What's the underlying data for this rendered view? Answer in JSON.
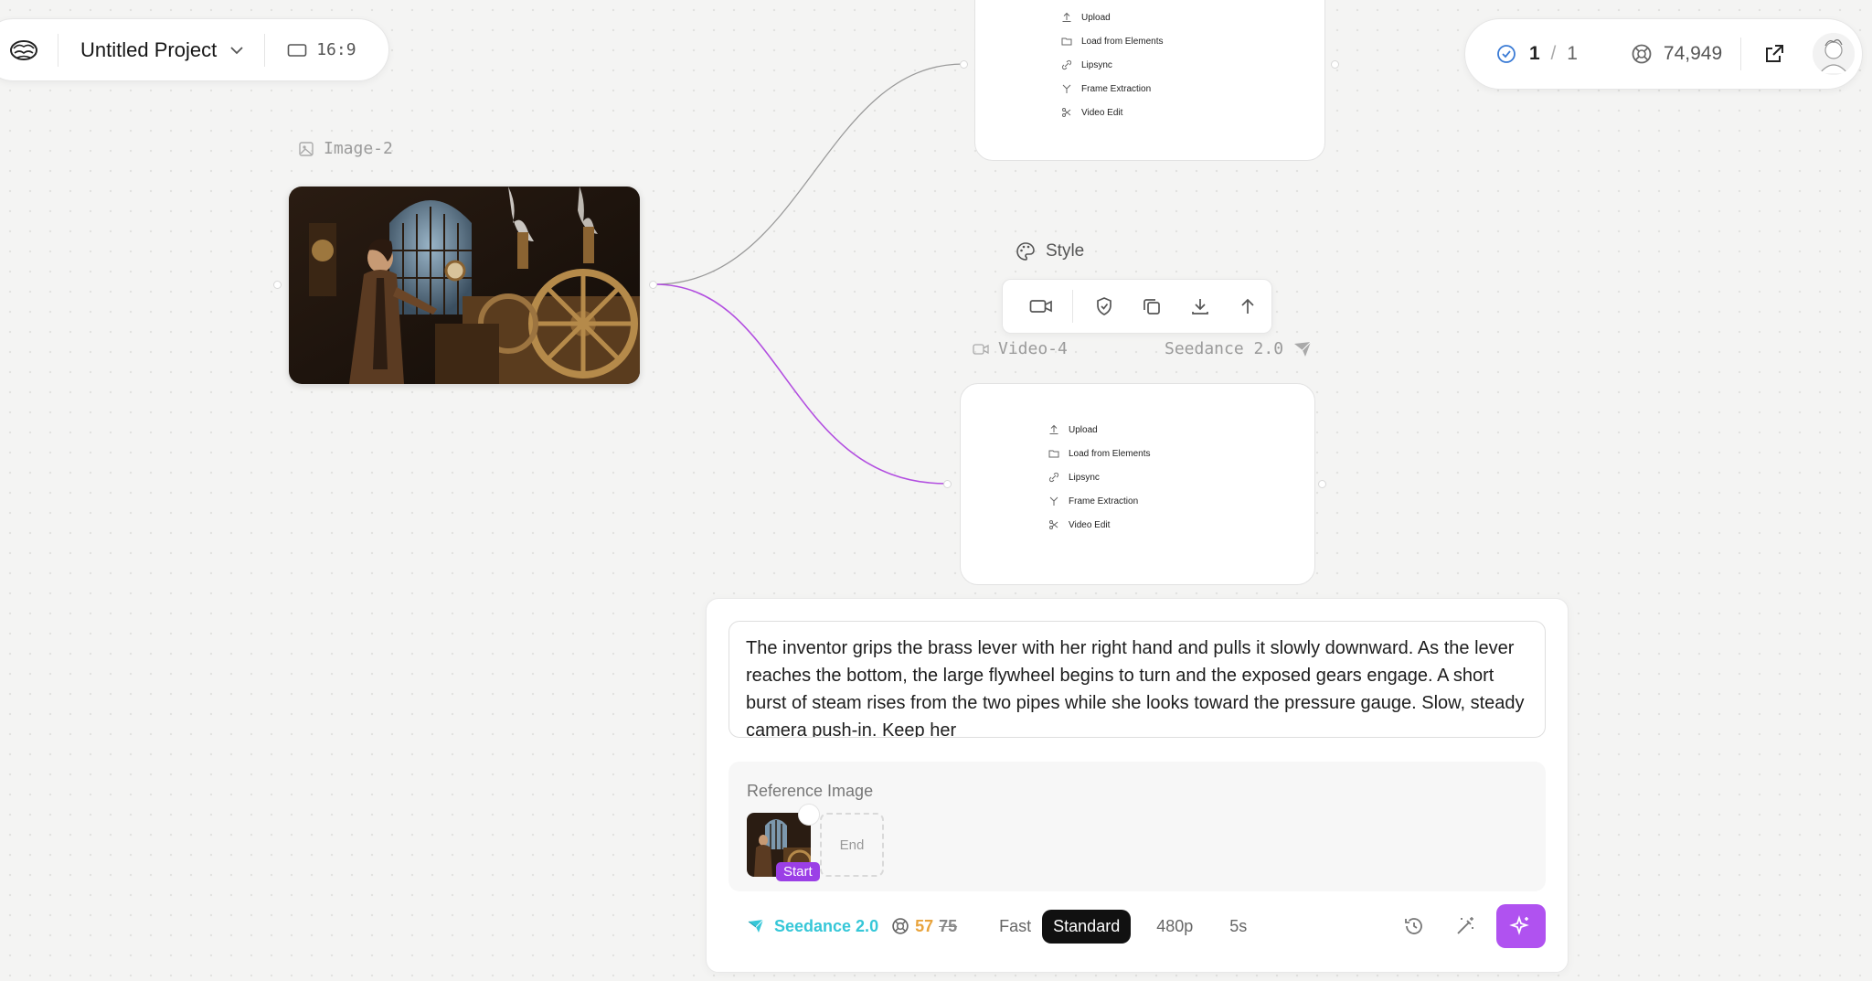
{
  "header": {
    "project_title": "Untitled Project",
    "aspect_ratio": "16:9"
  },
  "status": {
    "queue_done": "1",
    "queue_sep": "/",
    "queue_total": "1",
    "credits": "74,949"
  },
  "nodes": {
    "image_label": "Image-2",
    "style_label": "Style",
    "video_label": "Video-4",
    "video_model": "Seedance 2.0",
    "menu_items": [
      "Upload",
      "Load from Elements",
      "Lipsync",
      "Frame Extraction",
      "Video Edit"
    ]
  },
  "prompt": {
    "text": "The inventor grips the brass lever with her right hand and pulls it slowly downward. As the lever reaches the bottom, the large flywheel begins to turn and the exposed gears engage. A short burst of steam rises from the two pipes while she looks toward the pressure gauge. Slow, steady camera push-in. Keep her"
  },
  "reference": {
    "title": "Reference Image",
    "start_badge": "Start",
    "end_label": "End"
  },
  "controls": {
    "model": "Seedance 2.0",
    "cost_now": "57",
    "cost_was": "75",
    "speed_fast": "Fast",
    "speed_standard": "Standard",
    "resolution": "480p",
    "duration": "5s",
    "selected_speed": "Standard"
  },
  "colors": {
    "accent_purple": "#b052f0",
    "badge_purple": "#9b3fe6",
    "model_cyan": "#36c7d8",
    "cost_orange": "#e8a33c",
    "edge_gray": "#9a9a9a",
    "edge_purple": "#b24ee0"
  }
}
